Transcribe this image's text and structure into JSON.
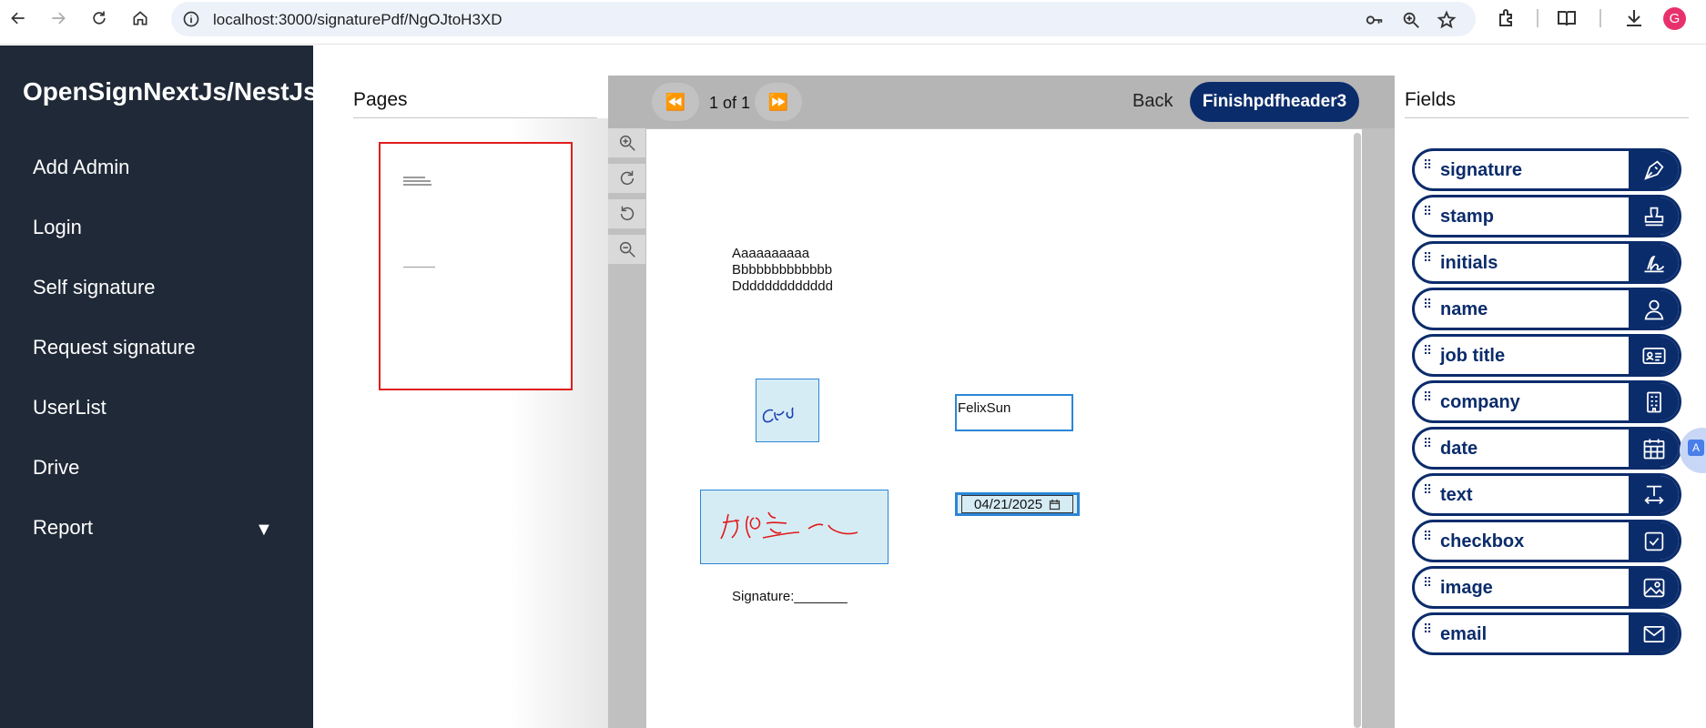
{
  "browser": {
    "url": "localhost:3000/signaturePdf/NgOJtoH3XD",
    "profile_initial": "G"
  },
  "sidebar": {
    "brand": "OpenSignNextJs/NestJs",
    "items": [
      {
        "label": "Add Admin"
      },
      {
        "label": "Login"
      },
      {
        "label": "Self signature"
      },
      {
        "label": "Request signature"
      },
      {
        "label": "UserList"
      },
      {
        "label": "Drive"
      },
      {
        "label": "Report"
      }
    ],
    "caret": "▼"
  },
  "pages_panel": {
    "title": "Pages"
  },
  "viewer": {
    "page_indicator": "1 of 1",
    "back_label": "Back",
    "finish_label": "Finishpdfheader3",
    "document": {
      "lines": [
        "Aaaaaaaaaa",
        "Bbbbbbbbbbbbb",
        "Ddddddddddddd"
      ],
      "signature_line": "Signature:_______",
      "name_value": "FelixSun",
      "date_value": "04/21/2025"
    }
  },
  "fields_panel": {
    "title": "Fields",
    "items": [
      {
        "label": "signature",
        "icon": "pen-nib-icon"
      },
      {
        "label": "stamp",
        "icon": "stamp-icon"
      },
      {
        "label": "initials",
        "icon": "initials-icon"
      },
      {
        "label": "name",
        "icon": "user-icon"
      },
      {
        "label": "job title",
        "icon": "id-card-icon"
      },
      {
        "label": "company",
        "icon": "building-icon"
      },
      {
        "label": "date",
        "icon": "calendar-icon"
      },
      {
        "label": "text",
        "icon": "text-cursor-icon"
      },
      {
        "label": "checkbox",
        "icon": "checkbox-icon"
      },
      {
        "label": "image",
        "icon": "image-icon"
      },
      {
        "label": "email",
        "icon": "envelope-icon"
      }
    ]
  },
  "colors": {
    "sidebar_bg": "#1f2937",
    "brand_navy": "#0b2c6b",
    "selection_blue": "#2b86d6",
    "thumb_border": "#e11d1d"
  }
}
